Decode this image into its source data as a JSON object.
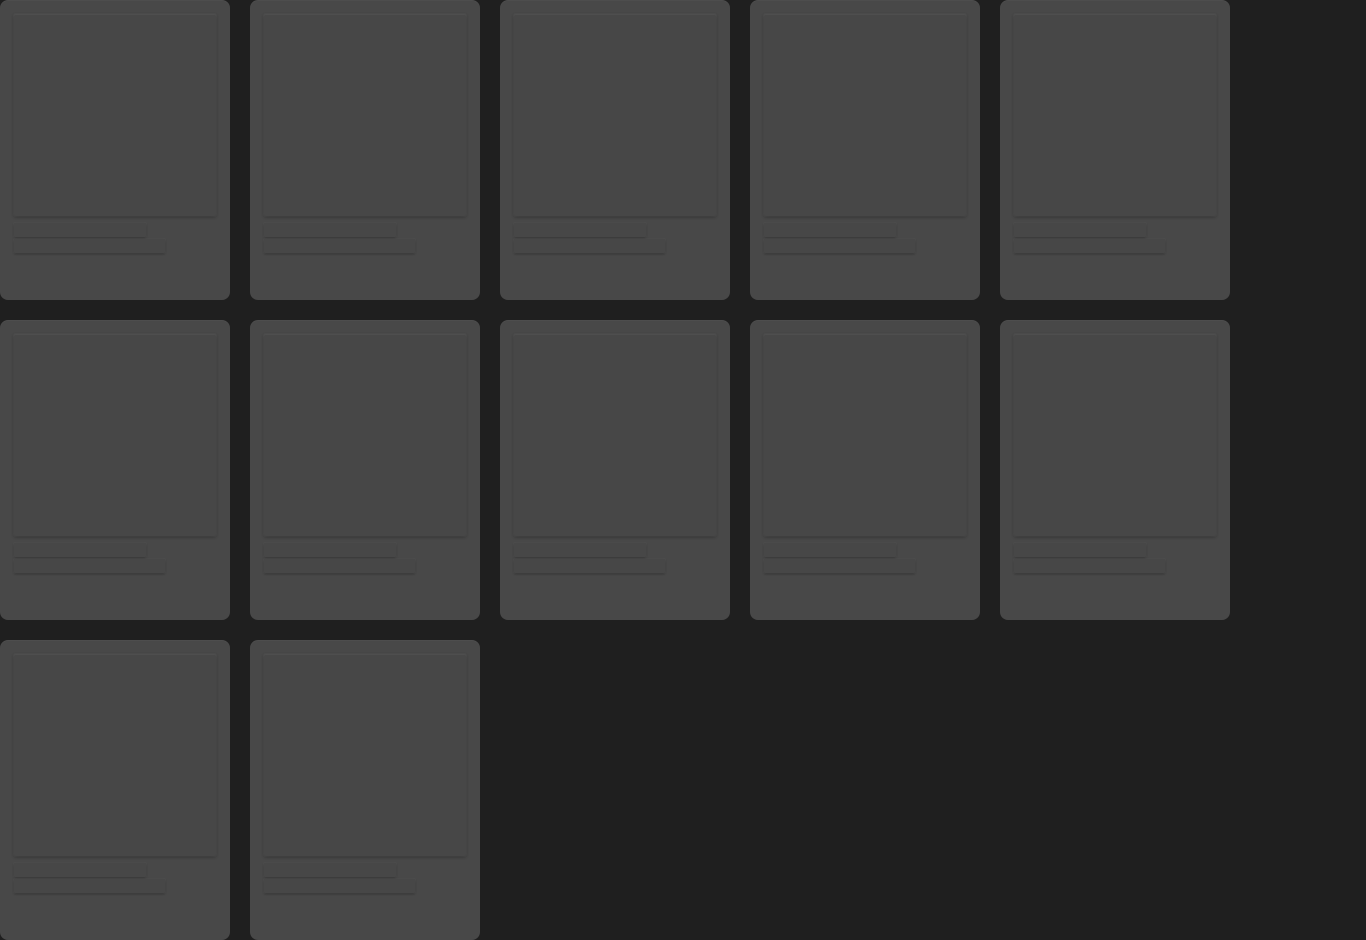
{
  "page": {
    "state": "loading-placeholders",
    "background_color": "#1f1f1f",
    "card_color": "#484848"
  },
  "grid": {
    "cards": [
      {
        "title": "",
        "subtitle": ""
      },
      {
        "title": "",
        "subtitle": ""
      },
      {
        "title": "",
        "subtitle": ""
      },
      {
        "title": "",
        "subtitle": ""
      },
      {
        "title": "",
        "subtitle": ""
      },
      {
        "title": "",
        "subtitle": ""
      },
      {
        "title": "",
        "subtitle": ""
      },
      {
        "title": "",
        "subtitle": ""
      },
      {
        "title": "",
        "subtitle": ""
      },
      {
        "title": "",
        "subtitle": ""
      },
      {
        "title": "",
        "subtitle": ""
      },
      {
        "title": "",
        "subtitle": ""
      }
    ]
  }
}
